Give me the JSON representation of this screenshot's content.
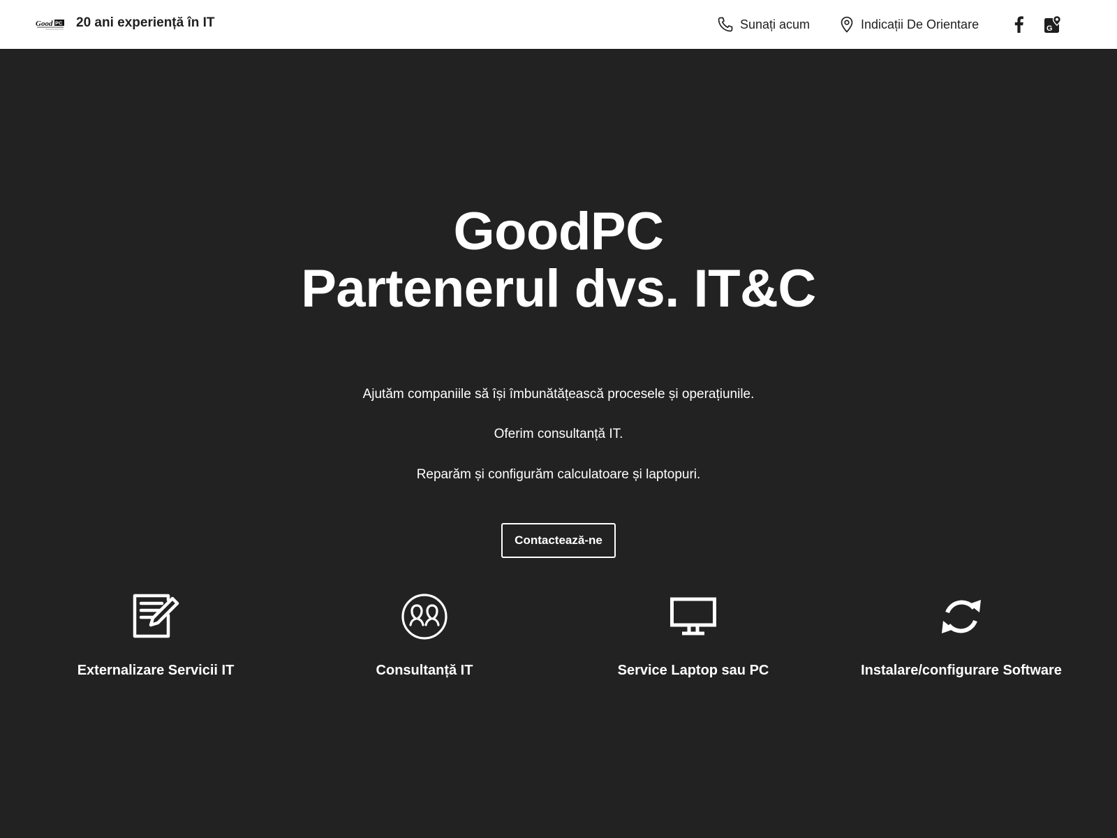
{
  "header": {
    "logo_text": "GoodPC",
    "tagline": "20 ani experiență în IT",
    "call_label": "Sunați acum",
    "directions_label": "Indicații De Orientare"
  },
  "hero": {
    "title_line1": "GoodPC",
    "title_line2": "Partenerul dvs. IT&C",
    "lines": [
      "Ajutăm companiile să își îmbunătățească procesele și operațiunile.",
      "Oferim consultanță IT.",
      "Reparăm și configurăm calculatoare și laptopuri."
    ],
    "cta_label": "Contactează-ne"
  },
  "services": [
    {
      "label": "Externalizare Servicii IT",
      "icon": "document-edit-icon"
    },
    {
      "label": "Consultanță IT",
      "icon": "consulting-people-icon"
    },
    {
      "label": "Service Laptop sau PC",
      "icon": "monitor-icon"
    },
    {
      "label": "Instalare/configurare Software",
      "icon": "refresh-icon"
    }
  ],
  "colors": {
    "header_bg": "#ffffff",
    "hero_bg": "#222222",
    "text_dark": "#1e1e1e",
    "text_light": "#ffffff"
  }
}
